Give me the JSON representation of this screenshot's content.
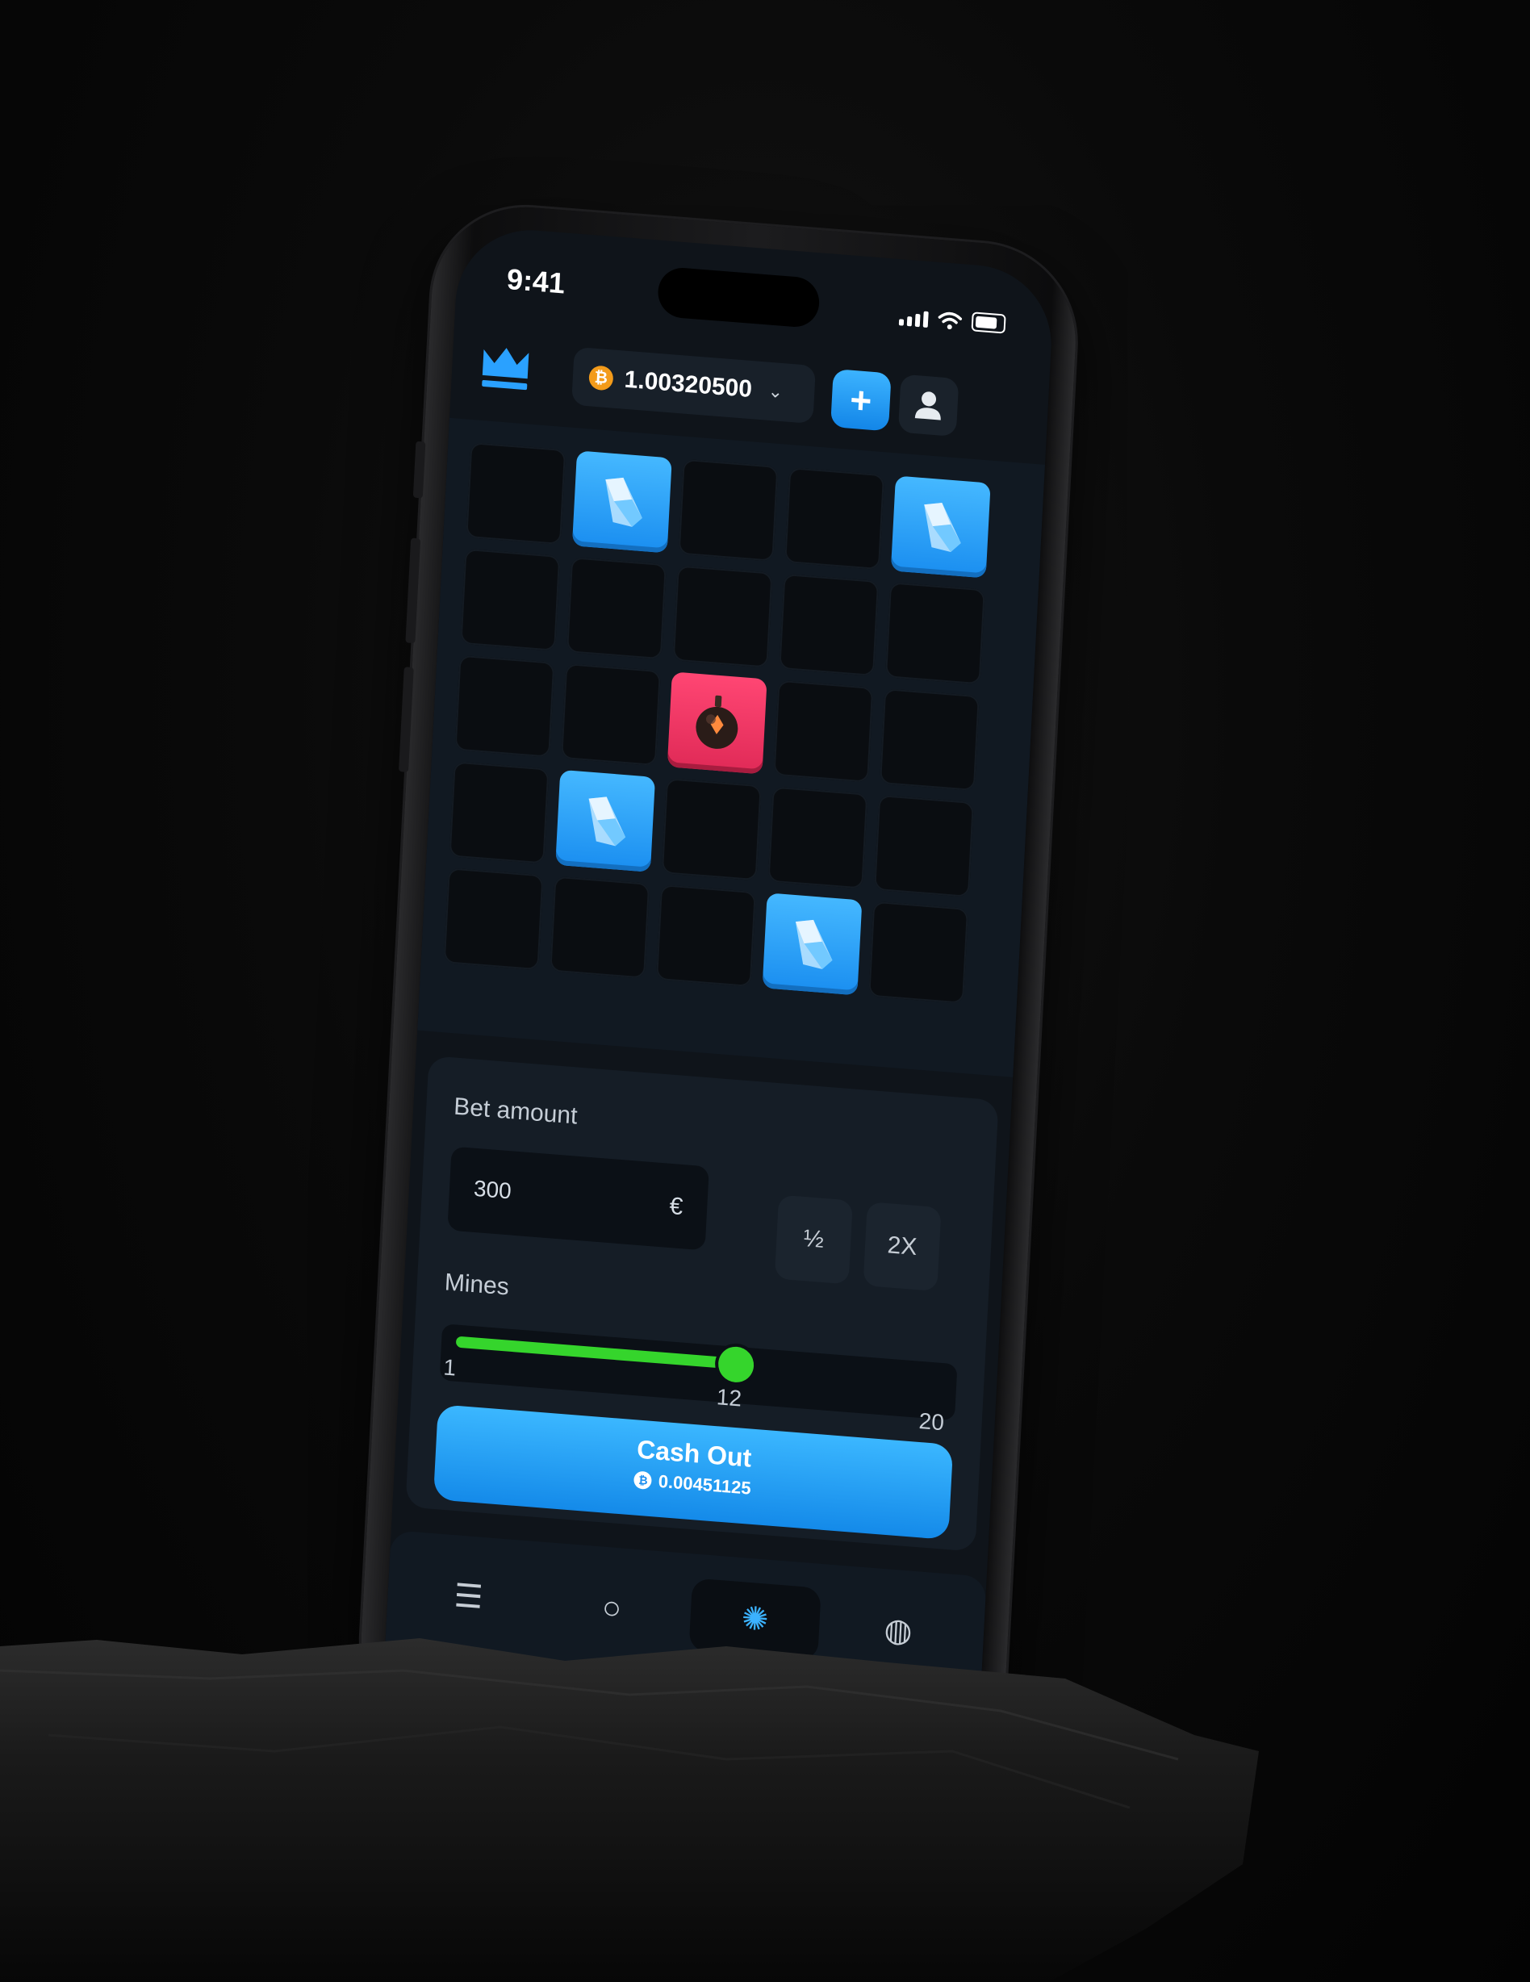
{
  "status_bar": {
    "time": "9:41"
  },
  "header": {
    "balance": "1.00320500",
    "currency_icon": "bitcoin-icon",
    "deposit_label": "+",
    "colors": {
      "accent": "#1a8ef0",
      "bitcoin": "#f39b1a"
    }
  },
  "board": {
    "rows": 5,
    "cols": 5,
    "tiles": [
      [
        "hidden",
        "gem",
        "hidden",
        "hidden",
        "gem"
      ],
      [
        "hidden",
        "hidden",
        "hidden",
        "hidden",
        "hidden"
      ],
      [
        "hidden",
        "hidden",
        "mine",
        "hidden",
        "hidden"
      ],
      [
        "hidden",
        "gem",
        "hidden",
        "hidden",
        "hidden"
      ],
      [
        "hidden",
        "hidden",
        "hidden",
        "gem",
        "hidden"
      ]
    ],
    "colors": {
      "gem": "#2aa1ff",
      "mine": "#f03662"
    }
  },
  "controls": {
    "bet_label": "Bet amount",
    "bet_value": "300",
    "bet_currency": "€",
    "half_label": "½",
    "double_label": "2X",
    "mines_label": "Mines",
    "mines_min": "1",
    "mines_value": "12",
    "mines_max": "20",
    "mines_fraction": 0.58,
    "cash_out_label": "Cash Out",
    "cash_out_amount": "0.00451125",
    "slider_color": "#35d52c"
  },
  "nav": {
    "items": [
      {
        "icon": "menu-icon",
        "glyph": "☰"
      },
      {
        "icon": "search-icon",
        "glyph": "○"
      },
      {
        "icon": "casino-chip-icon",
        "glyph": "✺"
      },
      {
        "icon": "basketball-icon",
        "glyph": "◍"
      }
    ],
    "active_index": 2
  }
}
